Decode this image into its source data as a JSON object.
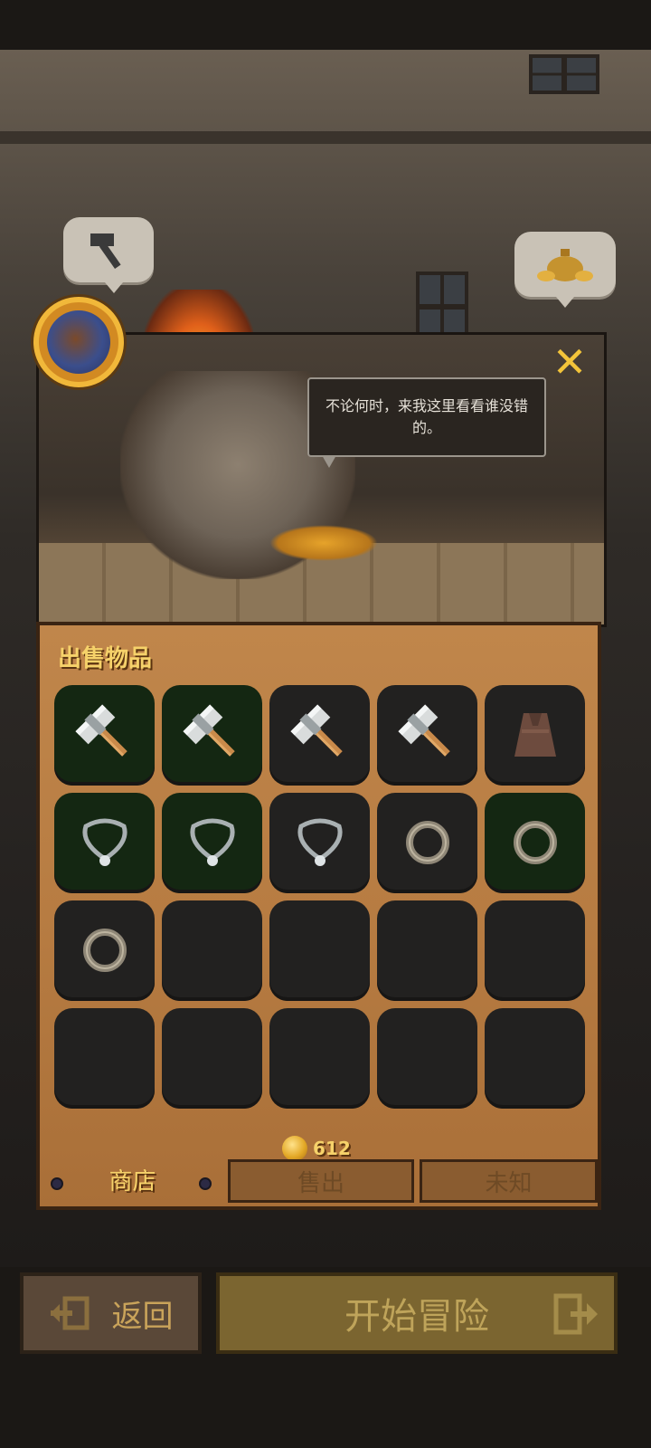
{
  "npc": {
    "dialogue": "不论何时，来我这里看看谁没错的。"
  },
  "shop": {
    "section_title": "出售物品",
    "gold": "612",
    "slots": [
      {
        "icon": "hammer-icon",
        "selected": true
      },
      {
        "icon": "hammer-icon",
        "selected": true
      },
      {
        "icon": "hammer-icon",
        "selected": false
      },
      {
        "icon": "hammer-icon",
        "selected": false
      },
      {
        "icon": "cloak-icon",
        "selected": false
      },
      {
        "icon": "necklace-icon",
        "selected": true
      },
      {
        "icon": "necklace-icon",
        "selected": true
      },
      {
        "icon": "necklace-icon",
        "selected": false
      },
      {
        "icon": "ring-icon",
        "selected": false
      },
      {
        "icon": "ring-icon",
        "selected": true
      },
      {
        "icon": "ring-icon",
        "selected": false
      },
      {
        "icon": "",
        "selected": false
      },
      {
        "icon": "",
        "selected": false
      },
      {
        "icon": "",
        "selected": false
      },
      {
        "icon": "",
        "selected": false
      },
      {
        "icon": "",
        "selected": false
      },
      {
        "icon": "",
        "selected": false
      },
      {
        "icon": "",
        "selected": false
      },
      {
        "icon": "",
        "selected": false
      },
      {
        "icon": "",
        "selected": false
      }
    ]
  },
  "tabs": [
    {
      "label": "商店",
      "active": true
    },
    {
      "label": "售出",
      "active": false
    },
    {
      "label": "未知",
      "active": false
    }
  ],
  "buttons": {
    "back": "返回",
    "start": "开始冒险"
  },
  "close_glyph": "✕",
  "colors": {
    "gold_text": "#f6d26a",
    "panel_wood": "#b77c42",
    "slot_selected": "#142712"
  }
}
